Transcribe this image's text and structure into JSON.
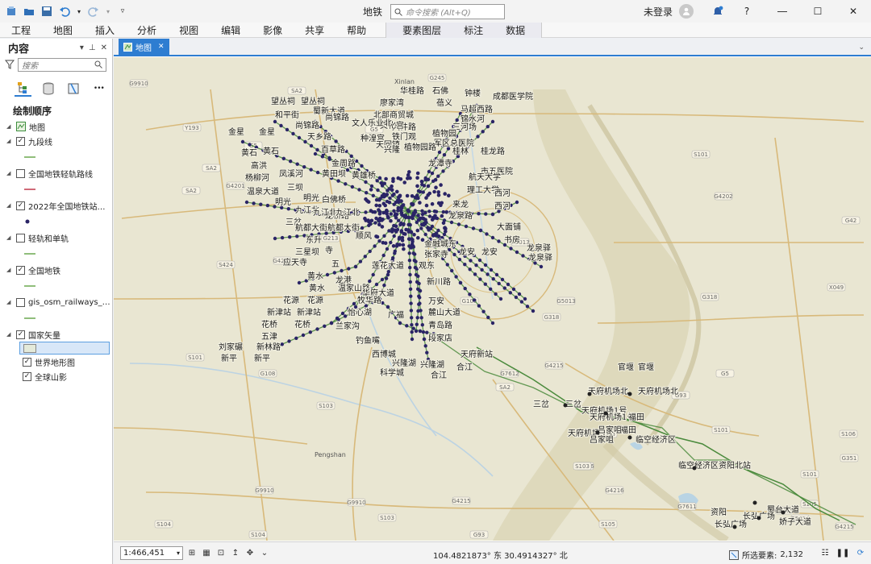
{
  "window": {
    "title": "地铁",
    "search_placeholder": "命令搜索 (Alt+Q)",
    "user": "未登录",
    "help": "?"
  },
  "ribbon": {
    "tabs": [
      "工程",
      "地图",
      "插入",
      "分析",
      "视图",
      "编辑",
      "影像",
      "共享",
      "帮助"
    ],
    "context_tabs": [
      "要素图层",
      "标注",
      "数据"
    ]
  },
  "contents": {
    "title": "内容",
    "search_placeholder": "搜索",
    "more": "•••",
    "drawing_order": "绘制顺序",
    "map_name": "地图",
    "layers": [
      {
        "name": "九段线",
        "checked": true,
        "legend": "green-line"
      },
      {
        "name": "全国地铁轻轨路线",
        "checked": false,
        "legend": "red-line"
      },
      {
        "name": "2022年全国地铁站…",
        "checked": true,
        "legend": "dot"
      },
      {
        "name": "轻轨和单轨",
        "checked": false,
        "legend": "green-line"
      },
      {
        "name": "全国地铁",
        "checked": true,
        "legend": "green-line"
      },
      {
        "name": "gis_osm_railways_…",
        "checked": false,
        "legend": "green-line"
      },
      {
        "name": "国家矢量",
        "checked": true,
        "legend": "swatch"
      },
      {
        "name": "世界地形图",
        "checked": true,
        "legend": "none"
      },
      {
        "name": "全球山影",
        "checked": true,
        "legend": "none"
      }
    ]
  },
  "map_view": {
    "tab_label": "地图",
    "colors": {
      "accent": "#2e7dd1",
      "station": "#2a2466",
      "metro_line": "#4a8a3c",
      "map_base": "#e9e6d2"
    },
    "place_labels": [
      "Xinlan",
      "Pengshan"
    ],
    "road_labels": [
      "G245",
      "G9910",
      "SA2",
      "Y193",
      "G5",
      "SA2",
      "G4202",
      "SA2",
      "G4201",
      "S424",
      "G213",
      "G5",
      "S101",
      "G4202",
      "G5013",
      "G42",
      "G318",
      "G5013",
      "G318",
      "G108",
      "S101",
      "G108",
      "G7612",
      "S103",
      "G4216",
      "S103",
      "G5",
      "G4215",
      "G318",
      "G7611",
      "S105",
      "G4215",
      "S104",
      "G9910",
      "S104",
      "G93",
      "S103",
      "G9910",
      "X049",
      "S101",
      "SA2",
      "G351",
      "S106",
      "S101",
      "G4215",
      "G93",
      "S105",
      "S103",
      "G5",
      "G5021",
      "G4216",
      "G4215"
    ],
    "stations": [
      "华桂路",
      "石佛",
      "钟楼",
      "成都医学院",
      "望丛祠",
      "望丛祠",
      "廖家湾",
      "蓓义",
      "马超西路",
      "和平街",
      "蜀新大道",
      "北部商贸城",
      "锦水河",
      "尚锦路",
      "尚锦路",
      "大件路",
      "文化宫",
      "文人乐业北",
      "三河场",
      "金星",
      "金星",
      "天乡路",
      "铁门观",
      "植物园",
      "种湟宫",
      "天回镇",
      "军区总医院",
      "百草路",
      "兴隆",
      "植物园路",
      "桂林",
      "桂龙路",
      "黄石",
      "黄石",
      "金周路",
      "龙潭寺",
      "市五医院",
      "高洪",
      "凤溪河",
      "黄田坝",
      "黄雄桥",
      "航天大学",
      "杨柳河",
      "理工大学",
      "温泉大道",
      "三坝",
      "西河",
      "西河",
      "明光",
      "明光",
      "白佛桥",
      "九江北",
      "龙桥路",
      "来龙",
      "九江北",
      "九江北",
      "龙泉路",
      "三岔",
      "航都大街",
      "航都大街",
      "大面铺",
      "顺风",
      "书房",
      "东升",
      "龙泉驿",
      "龙泉驿",
      "三星坝",
      "寺",
      "金融城东",
      "张家寺",
      "龙安",
      "龙安",
      "应天寺",
      "五",
      "莲花大道",
      "观东",
      "黄水",
      "龙港",
      "新川路",
      "黄水",
      "温家山路",
      "华府大道",
      "花源",
      "花源",
      "牧华路",
      "万安",
      "新津站",
      "新津站",
      "怡心湖",
      "广福",
      "麓山大道",
      "花桥",
      "花桥",
      "兰家沟",
      "青岛路",
      "五津",
      "钓鱼嘴",
      "段家店",
      "刘家碾",
      "新林路",
      "西博城",
      "天府新站",
      "新平",
      "新平",
      "兴隆湖",
      "兴隆湖",
      "合江",
      "合江",
      "科学城",
      "官堰",
      "官堰",
      "天府机场北",
      "天府机场北",
      "三岔",
      "三岔",
      "天府机场1号",
      "天府机场1号",
      "福田",
      "福田",
      "天府机场3号",
      "吕家咀",
      "吕家咀",
      "临空经济区",
      "临空经济区",
      "资阳北站",
      "蜀台大道",
      "娇子大道",
      "资阳",
      "长弘广场",
      "长弘广场"
    ],
    "scale": "1:466,451",
    "coordinates": "104.4821873° 东 30.4914327° 北",
    "selected_features_label": "所选要素:",
    "selected_features_count": "2,132"
  }
}
